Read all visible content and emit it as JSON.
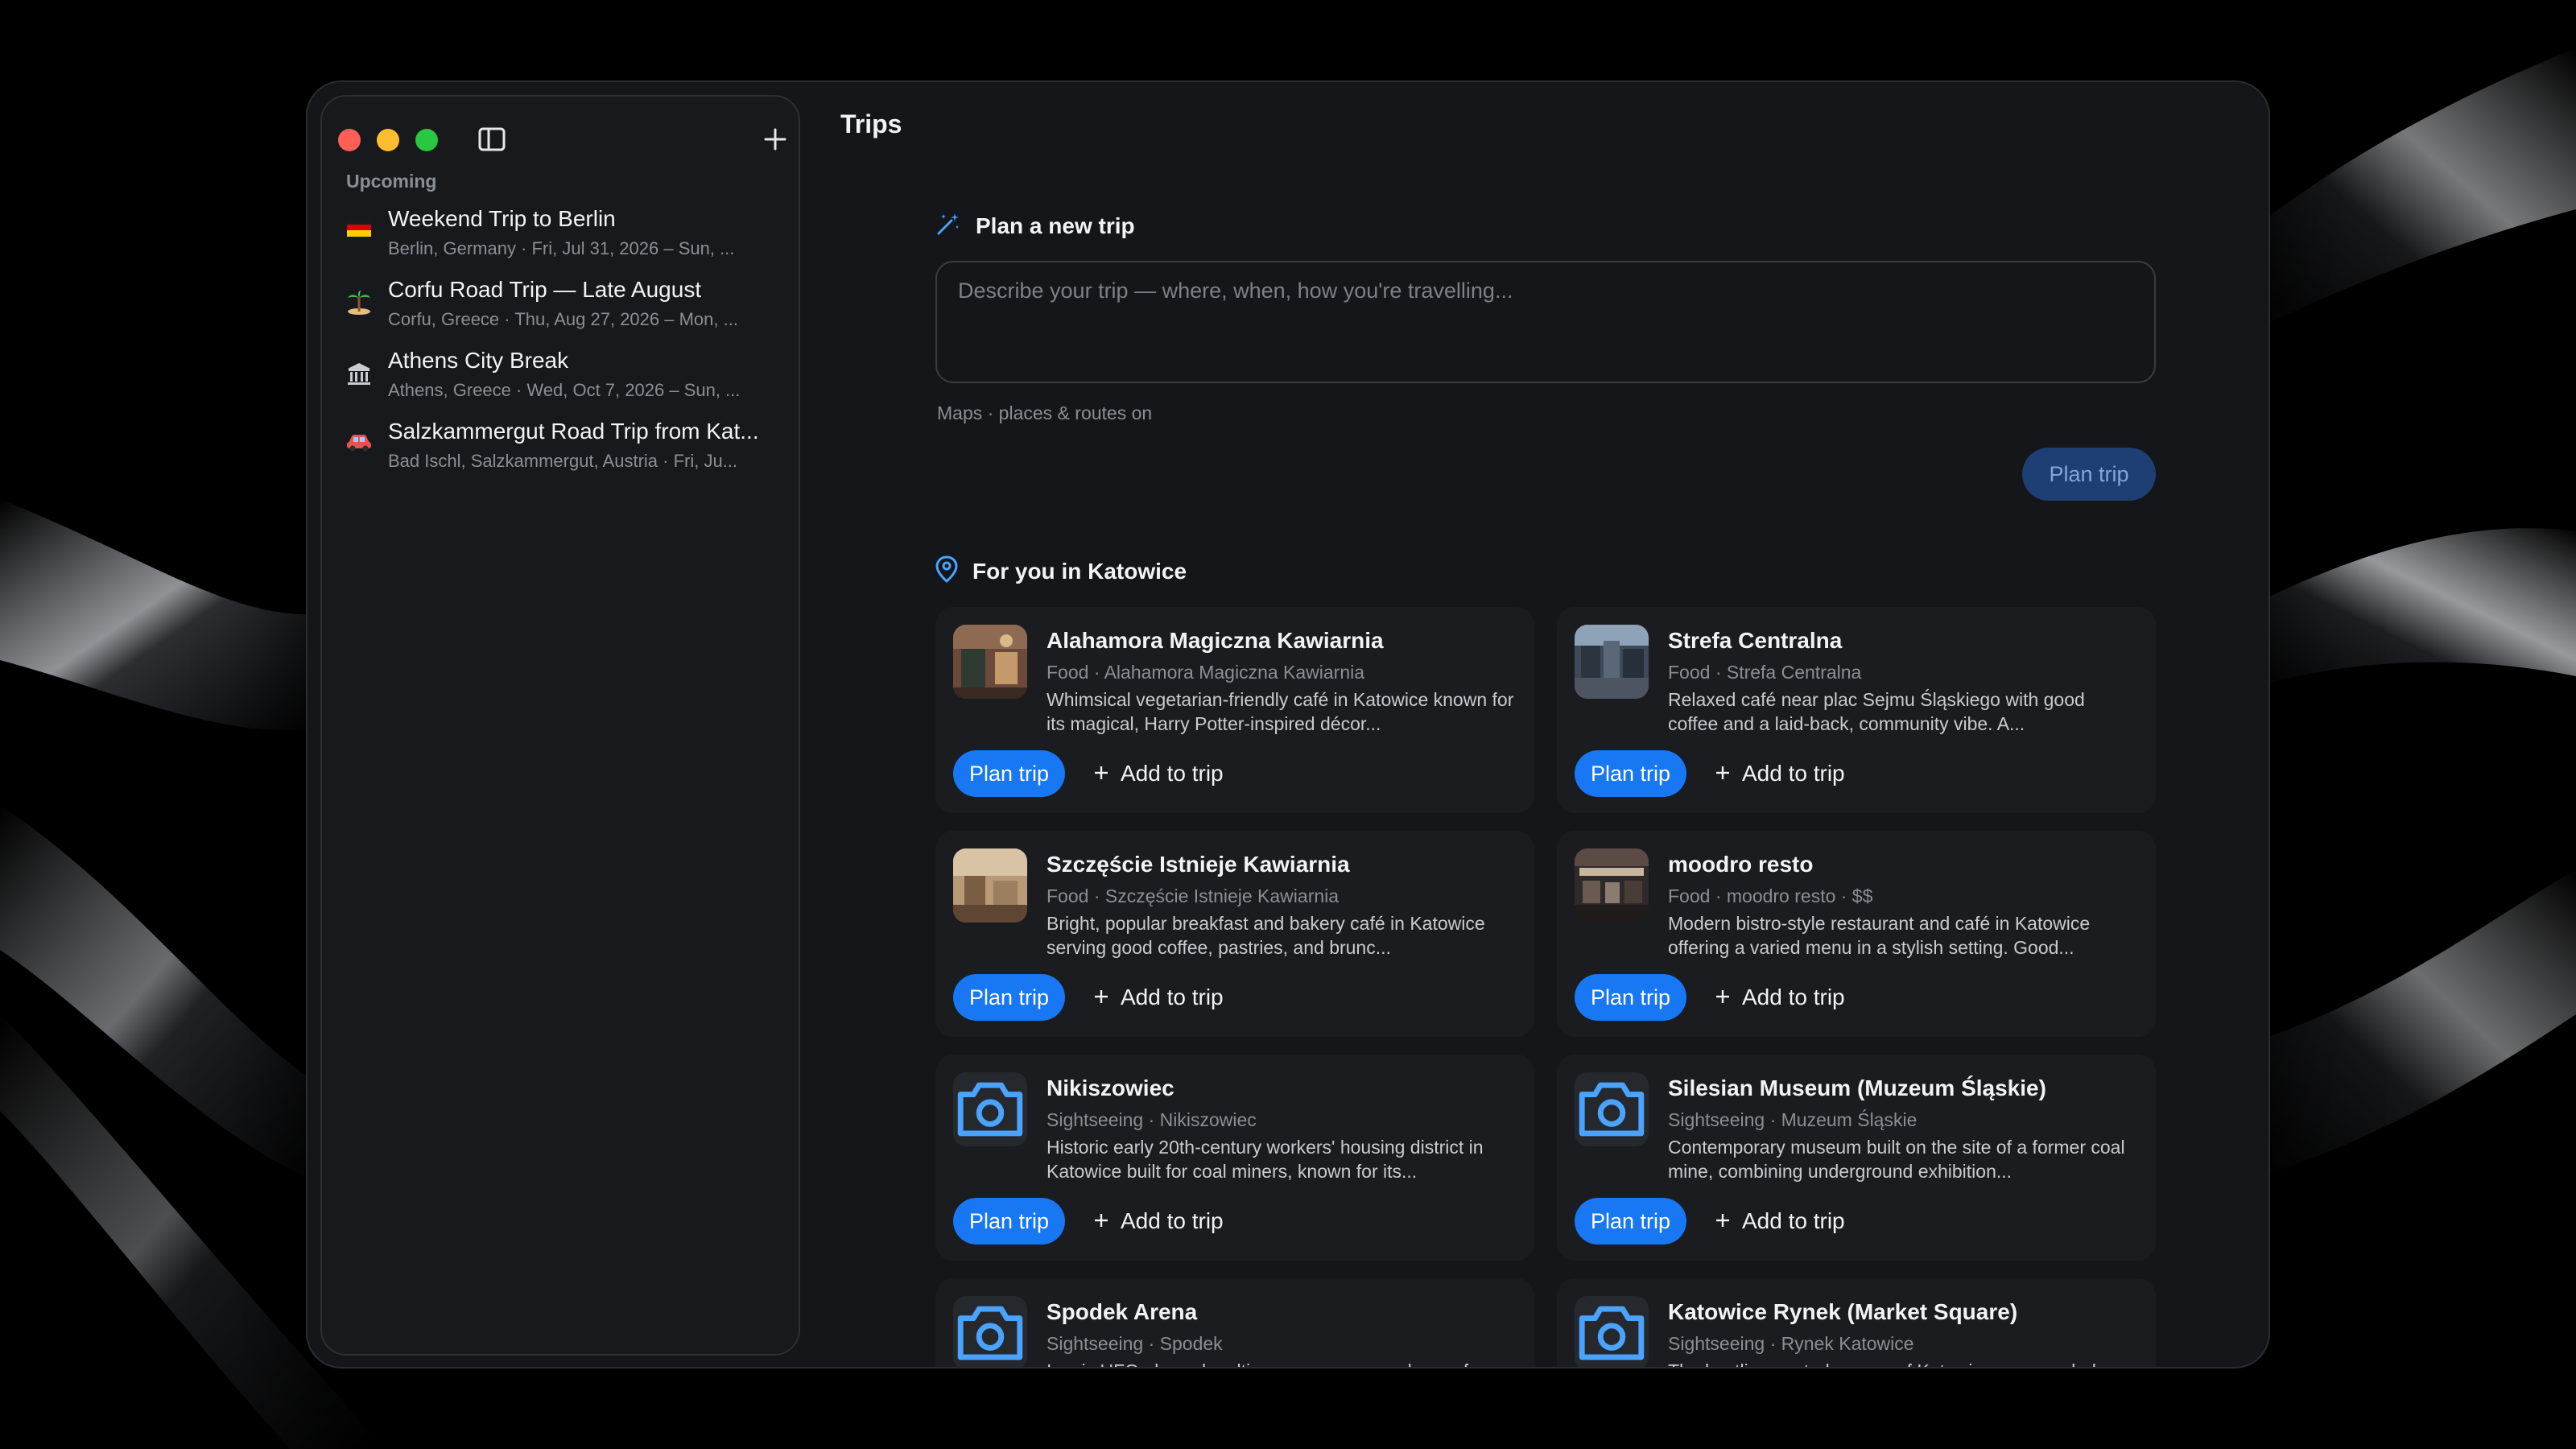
{
  "window": {
    "title": "Trips"
  },
  "sidebar": {
    "section_label": "Upcoming",
    "trips": [
      {
        "title": "Weekend Trip to Berlin",
        "subtitle": "Berlin, Germany · Fri, Jul 31, 2026 – Sun, ...",
        "icon": "germany-flag-icon"
      },
      {
        "title": "Corfu Road Trip — Late August",
        "subtitle": "Corfu, Greece · Thu, Aug 27, 2026 – Mon, ...",
        "icon": "island-icon"
      },
      {
        "title": "Athens City Break",
        "subtitle": "Athens, Greece · Wed, Oct 7, 2026 – Sun, ...",
        "icon": "classical-building-icon"
      },
      {
        "title": "Salzkammergut Road Trip from Kat...",
        "subtitle": "Bad Ischl, Salzkammergut, Austria · Fri, Ju...",
        "icon": "car-icon"
      }
    ]
  },
  "plan": {
    "heading": "Plan a new trip",
    "input_placeholder": "Describe your trip — where, when, how you're travelling...",
    "input_value": "",
    "maps_note": "Maps · places & routes on",
    "plan_button": "Plan trip"
  },
  "for_you": {
    "heading": "For you in Katowice",
    "plan_label": "Plan trip",
    "add_label": "Add to trip",
    "cards": [
      {
        "title": "Alahamora Magiczna Kawiarnia",
        "meta": "Food · Alahamora Magiczna Kawiarnia",
        "description": "Whimsical vegetarian-friendly café in Katowice known for its magical, Harry Potter-inspired décor...",
        "thumbnail": "photo"
      },
      {
        "title": "Strefa Centralna",
        "meta": "Food · Strefa Centralna",
        "description": "Relaxed café near plac Sejmu Śląskiego with good coffee and a laid-back, community vibe. A...",
        "thumbnail": "photo"
      },
      {
        "title": "Szczęście Istnieje Kawiarnia",
        "meta": "Food · Szczęście Istnieje Kawiarnia",
        "description": "Bright, popular breakfast and bakery café in Katowice serving good coffee, pastries, and brunc...",
        "thumbnail": "photo"
      },
      {
        "title": "moodro resto",
        "meta": "Food · moodro resto · $$",
        "description": "Modern bistro-style restaurant and café in Katowice offering a varied menu in a stylish setting. Good...",
        "thumbnail": "photo"
      },
      {
        "title": "Nikiszowiec",
        "meta": "Sightseeing · Nikiszowiec",
        "description": "Historic early 20th-century workers' housing district in Katowice built for coal miners, known for its...",
        "thumbnail": "camera-icon"
      },
      {
        "title": "Silesian Museum (Muzeum Śląskie)",
        "meta": "Sightseeing · Muzeum Śląskie",
        "description": "Contemporary museum built on the site of a former coal mine, combining underground exhibition...",
        "thumbnail": "camera-icon"
      },
      {
        "title": "Spodek Arena",
        "meta": "Sightseeing · Spodek",
        "description": "Iconic UFO-shaped multi-purpose arena and one of...",
        "thumbnail": "camera-icon"
      },
      {
        "title": "Katowice Rynek (Market Square)",
        "meta": "Sightseeing · Rynek Katowice",
        "description": "The bustling central square of Katowice, surrounded...",
        "thumbnail": "camera-icon"
      }
    ]
  },
  "colors": {
    "accent": "#1877f2",
    "accent_disabled": "#1d3f73",
    "window_bg": "#141619",
    "card_bg": "#1a1c20",
    "icon_blue": "#4aa3ff"
  }
}
